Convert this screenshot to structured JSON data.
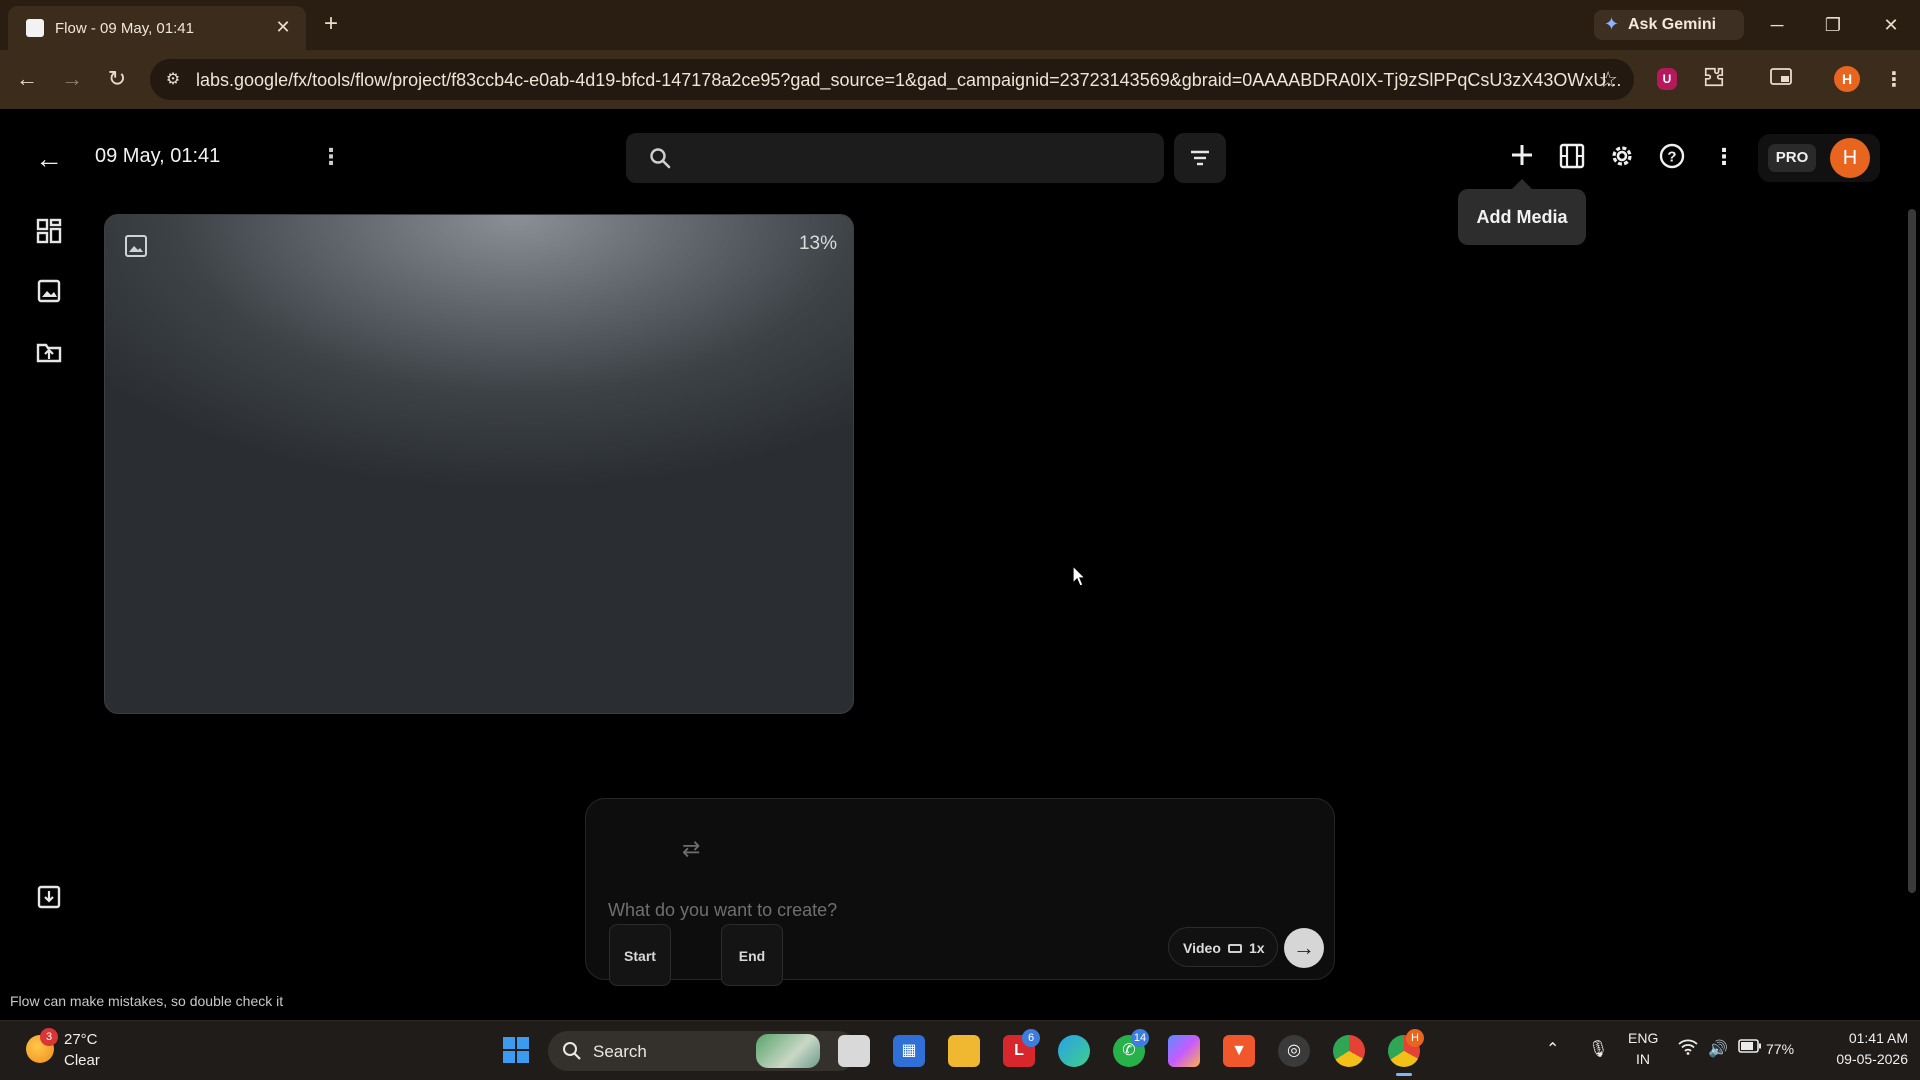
{
  "browser": {
    "tab_title": "Flow - 09 May, 01:41",
    "tab_close": "✕",
    "new_tab": "+",
    "ask_gemini": "Ask Gemini",
    "url": "labs.google/fx/tools/flow/project/f83ccb4c-e0ab-4d19-bfcd-147178a2ce95?gad_source=1&gad_campaignid=23723143569&gbraid=0AAAABDRA0IX-Tj9zSlPPqCsU3zX43OWxU...",
    "profile_initial": "H",
    "shield_label": "U"
  },
  "app": {
    "project_title": "09 May, 01:41",
    "search_placeholder": "",
    "tooltip": "Add Media",
    "pro_badge": "PRO",
    "avatar_initial": "H",
    "media_card": {
      "progress_label": "13%",
      "progress": 0.13
    },
    "composer": {
      "start_label": "Start",
      "end_label": "End",
      "placeholder": "What do you want to create?",
      "mode_label": "Video",
      "count_label": "1x"
    },
    "disclaimer": "Flow can make mistakes, so double check it"
  },
  "taskbar": {
    "weather_temp": "27°C",
    "weather_cond": "Clear",
    "weather_badge": "3",
    "search_label": "Search",
    "badge_l": "6",
    "badge_whatsapp": "14",
    "badge_chrome_profile": "H",
    "lang_top": "ENG",
    "lang_bottom": "IN",
    "battery": "77%",
    "time": "01:41 AM",
    "date": "09-05-2026"
  },
  "colors": {
    "accent_orange": "#e8651f",
    "chrome_bg": "#3b2c1c",
    "app_bg": "#000000"
  }
}
